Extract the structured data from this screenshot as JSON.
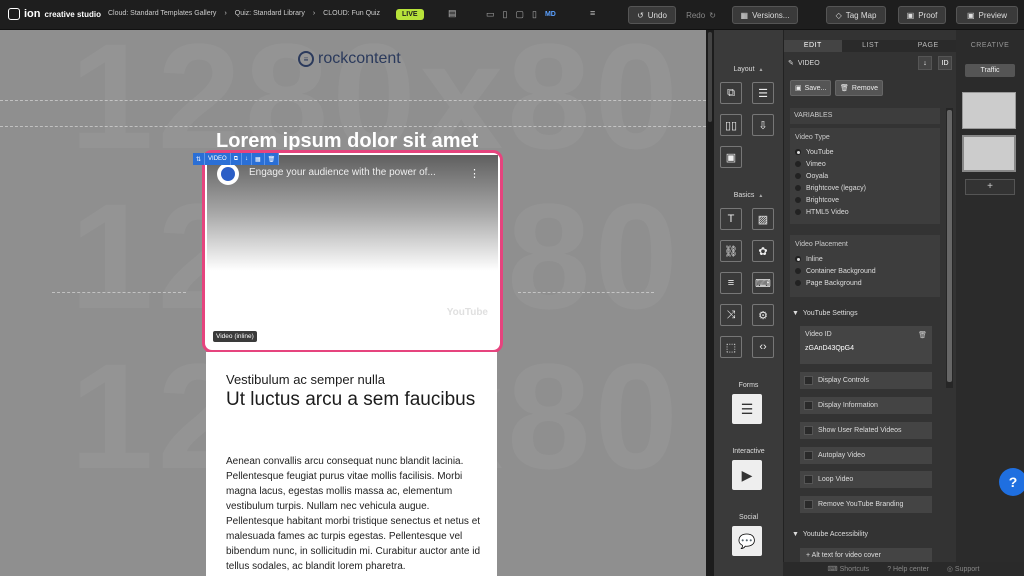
{
  "topbar": {
    "logo_ion": "ion",
    "logo_sub": "creative studio",
    "breadcrumbs": [
      "Cloud: Standard Templates Gallery",
      "Quiz: Standard Library",
      "CLOUD: Fun Quiz"
    ],
    "live_label": "LIVE",
    "device_label": "MD",
    "undo_label": "Undo",
    "redo_label": "Redo",
    "versions_label": "Versions...",
    "tagmap_label": "Tag Map",
    "proof_label": "Proof",
    "preview_label": "Preview",
    "live_color": "#b7e23a"
  },
  "canvas": {
    "bg_text": [
      "1280x80",
      "1280x80",
      "1280x80"
    ],
    "brand": "rockcontent",
    "headline": "Lorem ipsum dolor sit amet",
    "video_toolbar_label": "VIDEO",
    "video_title": "Engage your audience with the power of...",
    "video_platform": "YouTube",
    "video_label": "Video (inline)",
    "highlight_color": "#e6447e",
    "card": {
      "pre_title": "Vestibulum ac semper nulla",
      "title": "Ut luctus arcu a sem faucibus",
      "body": "Aenean convallis arcu consequat nunc blandit lacinia. Pellentesque feugiat purus vitae mollis facilisis. Morbi magna lacus, egestas mollis massa ac, elementum vestibulum turpis. Nullam nec vehicula augue. Pellentesque habitant morbi tristique senectus et netus et malesuada fames ac turpis egestas. Pellentesque vel bibendum nunc, in sollicitudin mi. Curabitur auctor ante id tellus sodales, ac blandit lorem pharetra."
    }
  },
  "widgets": {
    "layout": "Layout",
    "basics": "Basics",
    "forms": "Forms",
    "interactive": "Interactive",
    "social": "Social"
  },
  "panel": {
    "tabs": [
      "EDIT",
      "LIST",
      "PAGE"
    ],
    "creative_tab": "CREATIVE",
    "element_name": "VIDEO",
    "id_label": "ID",
    "save_label": "Save...",
    "remove_label": "Remove",
    "variables_label": "VARIABLES",
    "video_type_title": "Video Type",
    "video_types": [
      "YouTube",
      "Vimeo",
      "Ooyala",
      "Brightcove (legacy)",
      "Brightcove",
      "HTML5 Video"
    ],
    "placement_title": "Video Placement",
    "placements": [
      "Inline",
      "Container Background",
      "Page Background"
    ],
    "youtube_settings": "YouTube Settings",
    "video_id_label": "Video ID",
    "video_id_value": "zGAnD43QpG4",
    "checkboxes": [
      "Display Controls",
      "Display Information",
      "Show User Related Videos",
      "Autoplay Video",
      "Loop Video",
      "Remove YouTube Branding"
    ],
    "accessibility": "Youtube Accessibility",
    "alt_text": "+ Alt text for video cover"
  },
  "creative": {
    "traffic_label": "Traffic",
    "add_label": "+"
  },
  "footer": {
    "shortcuts": "Shortcuts",
    "help": "Help center",
    "support": "Support"
  },
  "help_button": "?"
}
